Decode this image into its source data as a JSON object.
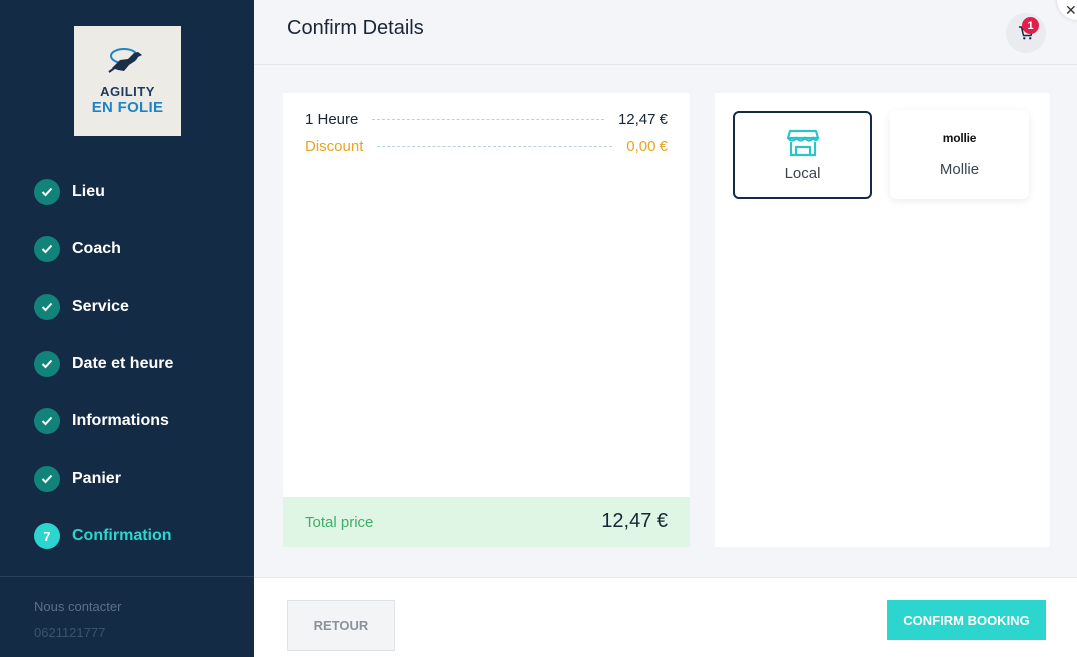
{
  "sidebar": {
    "logo": {
      "line1": "AGILITY",
      "line2": "EN FOLIE"
    },
    "steps": [
      {
        "number": "",
        "label": "Lieu",
        "status": "done"
      },
      {
        "number": "",
        "label": "Coach",
        "status": "done"
      },
      {
        "number": "",
        "label": "Service",
        "status": "done"
      },
      {
        "number": "",
        "label": "Date et heure",
        "status": "done"
      },
      {
        "number": "",
        "label": "Informations",
        "status": "done"
      },
      {
        "number": "",
        "label": "Panier",
        "status": "done"
      },
      {
        "number": "7",
        "label": "Confirmation",
        "status": "active"
      }
    ],
    "contact": {
      "title": "Nous contacter",
      "phone": "0621121777"
    }
  },
  "header": {
    "title": "Confirm Details",
    "cart_count": "1",
    "cart_icon": "cart-icon",
    "close_icon": "close-icon"
  },
  "summary": {
    "item": {
      "label": "1 Heure",
      "value": "12,47 €"
    },
    "discount": {
      "label": "Discount",
      "value": "0,00 €"
    },
    "total": {
      "label": "Total price",
      "value": "12,47 €"
    }
  },
  "payment": {
    "options": [
      {
        "label": "Local",
        "icon": "store-icon",
        "selected": true
      },
      {
        "label": "Mollie",
        "logo_text": "mollie",
        "selected": false
      }
    ]
  },
  "footer": {
    "back_label": "RETOUR",
    "confirm_label": "CONFIRM BOOKING"
  },
  "colors": {
    "sidebar_bg": "#142b46",
    "accent": "#2cd5cd",
    "done_step": "#12837a",
    "discount": "#e8a41f",
    "total_bg": "#dff6e4",
    "total_text": "#3fae6a",
    "badge": "#e0204a"
  }
}
